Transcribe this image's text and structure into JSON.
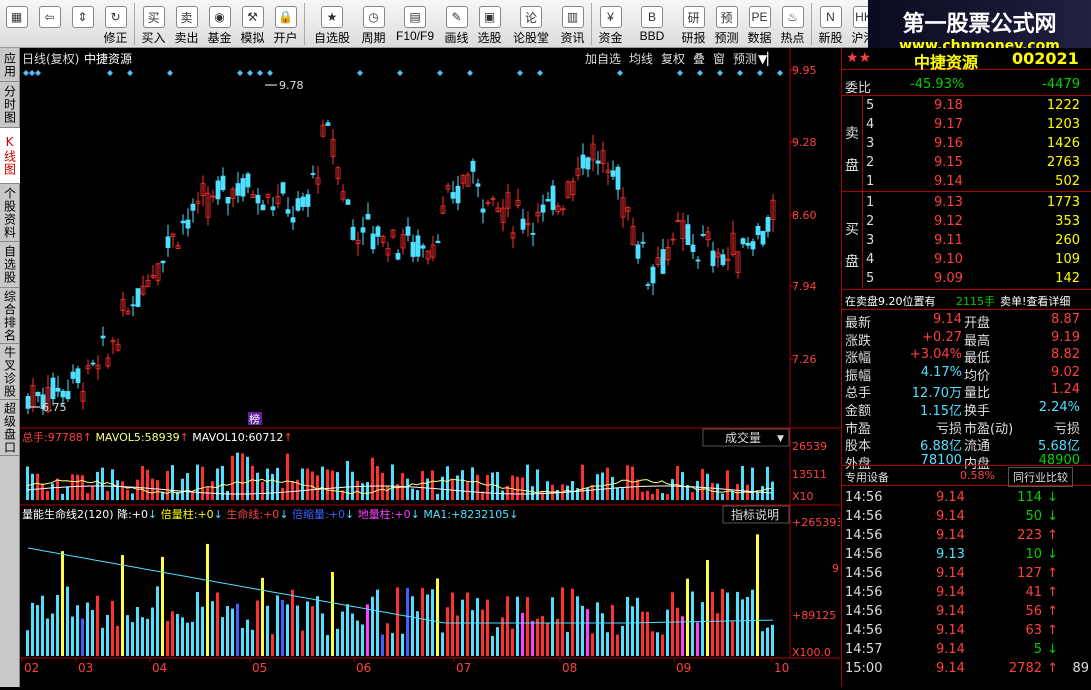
{
  "toolbar": [
    {
      "label": "",
      "icon": "windows-logo-icon"
    },
    {
      "label": "",
      "icon": "back-arrow-icon"
    },
    {
      "label": "",
      "icon": "up-down-arrow-icon"
    },
    {
      "label": "修正",
      "icon": "refresh-icon"
    },
    {
      "label": "买入",
      "icon": "buy-icon"
    },
    {
      "label": "卖出",
      "icon": "sell-icon"
    },
    {
      "label": "基金",
      "icon": "fund-icon"
    },
    {
      "label": "模拟",
      "icon": "hammer-icon"
    },
    {
      "label": "开户",
      "icon": "lock-icon"
    },
    {
      "label": "自选股",
      "icon": "star-icon"
    },
    {
      "label": "周期",
      "icon": "clock-icon"
    },
    {
      "label": "F10/F9",
      "icon": "f10-icon"
    },
    {
      "label": "画线",
      "icon": "pen-icon"
    },
    {
      "label": "选股",
      "icon": "monitor-icon"
    },
    {
      "label": "论股堂",
      "icon": "discuss-icon"
    },
    {
      "label": "资讯",
      "icon": "news-icon"
    },
    {
      "label": "资金",
      "icon": "money-icon"
    },
    {
      "label": "BBD",
      "icon": "bbd-icon"
    },
    {
      "label": "研报",
      "icon": "report-icon"
    },
    {
      "label": "预测",
      "icon": "forecast-icon"
    },
    {
      "label": "数据",
      "icon": "pe-icon"
    },
    {
      "label": "热点",
      "icon": "hot-icon"
    },
    {
      "label": "新股",
      "icon": "new-stock-icon"
    },
    {
      "label": "沪港",
      "icon": "hk-icon"
    }
  ],
  "brand": {
    "title": "第一股票公式网",
    "url": "www.chnmoney.com"
  },
  "left_tabs": [
    "应用",
    "分时图",
    "K线图",
    "个股资料",
    "自选股",
    "综合排名",
    "牛叉诊股",
    "超级盘口"
  ],
  "kline": {
    "header_left": "日线(复权)",
    "stock_name": "中捷资源",
    "header_buttons": [
      "加自选",
      "均线",
      "复权",
      "叠",
      "窗",
      "预测"
    ],
    "price_levels": [
      "9.95",
      "9.28",
      "8.60",
      "7.94",
      "7.26"
    ],
    "high_label": "9.78",
    "low_label": "6.75",
    "bang_label": "榜",
    "volume_legend": {
      "total_label": "总手:",
      "total": "97788",
      "mavol5_label": "MAVOL5:",
      "mavol5": "58939",
      "mavol10_label": "MAVOL10:",
      "mavol10": "60712"
    },
    "volume_dropdown": "成交量",
    "volume_levels": [
      "26539",
      "13511",
      "X10"
    ],
    "indicator_legend": [
      {
        "label": "量能生命线2(120) 降:",
        "value": "+0",
        "color": "#ffffff"
      },
      {
        "label": "倍量柱:",
        "value": "+0",
        "color": "#ffff00"
      },
      {
        "label": "生命线:",
        "value": "+0",
        "color": "#ff4040"
      },
      {
        "label": "倍缩量:",
        "value": "+0",
        "color": "#4060ff"
      },
      {
        "label": "地量柱:",
        "value": "+0",
        "color": "#ff40ff"
      },
      {
        "label": "MA1:",
        "value": "+8232105",
        "color": "#50e0ff"
      }
    ],
    "indicator_button": "指标说明",
    "indicator_levels": [
      "+265393",
      "9",
      "+89125",
      "X100.0"
    ],
    "months": [
      "02",
      "03",
      "04",
      "05",
      "06",
      "07",
      "08",
      "09",
      "10"
    ]
  },
  "quote": {
    "name": "中捷资源",
    "code": "002021",
    "weibi_label": "委比",
    "weibi": "-45.93%",
    "weicha": "-4479",
    "sell_label": "卖盘",
    "buy_label": "买盘",
    "sells": [
      {
        "n": "5",
        "p": "9.18",
        "v": "1222"
      },
      {
        "n": "4",
        "p": "9.17",
        "v": "1203"
      },
      {
        "n": "3",
        "p": "9.16",
        "v": "1426"
      },
      {
        "n": "2",
        "p": "9.15",
        "v": "2763"
      },
      {
        "n": "1",
        "p": "9.14",
        "v": "502"
      }
    ],
    "buys": [
      {
        "n": "1",
        "p": "9.13",
        "v": "1773"
      },
      {
        "n": "2",
        "p": "9.12",
        "v": "353"
      },
      {
        "n": "3",
        "p": "9.11",
        "v": "260"
      },
      {
        "n": "4",
        "p": "9.10",
        "v": "109"
      },
      {
        "n": "5",
        "p": "9.09",
        "v": "142"
      }
    ],
    "notice": "在卖盘9.20位置有",
    "notice_vol": "2115手",
    "notice_link": "卖单!查看详细",
    "stats": [
      [
        "最新",
        "9.14",
        "开盘",
        "8.87"
      ],
      [
        "涨跌",
        "+0.27",
        "最高",
        "9.19"
      ],
      [
        "涨幅",
        "+3.04%",
        "最低",
        "8.82"
      ],
      [
        "振幅",
        "4.17%",
        "均价",
        "9.02"
      ],
      [
        "总手",
        "12.70万",
        "量比",
        "1.24"
      ],
      [
        "金额",
        "1.15亿",
        "换手",
        "2.24%"
      ],
      [
        "市盈",
        "亏损",
        "市盈(动)",
        "亏损"
      ],
      [
        "股本",
        "6.88亿",
        "流通",
        "5.68亿"
      ],
      [
        "外盘",
        "78100",
        "内盘",
        "48900"
      ]
    ],
    "sector": "专用设备",
    "sector_pct": "0.58%",
    "sector_btn": "同行业比较",
    "ticks": [
      {
        "t": "14:56",
        "p": "9.14",
        "v": "114",
        "d": "down"
      },
      {
        "t": "14:56",
        "p": "9.14",
        "v": "50",
        "d": "down"
      },
      {
        "t": "14:56",
        "p": "9.14",
        "v": "223",
        "d": "up"
      },
      {
        "t": "14:56",
        "p": "9.13",
        "v": "10",
        "d": "down"
      },
      {
        "t": "14:56",
        "p": "9.14",
        "v": "127",
        "d": "up"
      },
      {
        "t": "14:56",
        "p": "9.14",
        "v": "41",
        "d": "up"
      },
      {
        "t": "14:56",
        "p": "9.14",
        "v": "56",
        "d": "up"
      },
      {
        "t": "14:56",
        "p": "9.14",
        "v": "63",
        "d": "up"
      },
      {
        "t": "14:57",
        "p": "9.14",
        "v": "5",
        "d": "down"
      },
      {
        "t": "15:00",
        "p": "9.14",
        "v": "2782",
        "d": "up",
        "extra": "89"
      }
    ]
  }
}
